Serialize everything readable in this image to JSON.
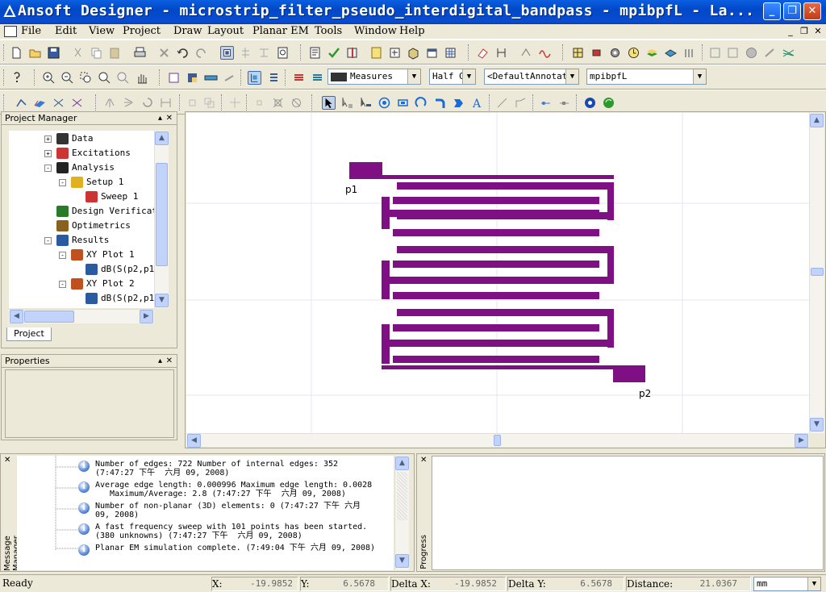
{
  "window": {
    "title": "Ansoft Designer  - microstrip_filter_pseudo_interdigital_bandpass - mpibpfL - La...",
    "buttons": {
      "minimize": "_",
      "maximize": "❐",
      "close": "✕"
    }
  },
  "menu": {
    "items": [
      "File",
      "Edit",
      "View",
      "Project",
      "Draw",
      "Layout",
      "Planar EM",
      "Tools",
      "Window",
      "Help"
    ],
    "mdi": {
      "minimize": "_",
      "restore": "❐",
      "close": "✕"
    }
  },
  "toolbar": {
    "layer_combo": "Measures",
    "snap_combo": "Half G",
    "annotation_combo": "<DefaultAnnotati",
    "design_combo": "mpibpfL"
  },
  "project_manager": {
    "title": "Project Manager",
    "tab": "Project",
    "tree": [
      {
        "label": "Data",
        "indent": 0,
        "expander": "+",
        "icon": "data-icon"
      },
      {
        "label": "Excitations",
        "indent": 0,
        "expander": "+",
        "icon": "excitations-icon"
      },
      {
        "label": "Analysis",
        "indent": 0,
        "expander": "-",
        "icon": "analysis-icon"
      },
      {
        "label": "Setup 1",
        "indent": 1,
        "expander": "-",
        "icon": "setup-icon"
      },
      {
        "label": "Sweep 1",
        "indent": 2,
        "expander": "",
        "icon": "sweep-icon"
      },
      {
        "label": "Design Verificati",
        "indent": 0,
        "expander": "",
        "icon": "verification-icon"
      },
      {
        "label": "Optimetrics",
        "indent": 0,
        "expander": "",
        "icon": "optimetrics-icon"
      },
      {
        "label": "Results",
        "indent": 0,
        "expander": "-",
        "icon": "results-icon"
      },
      {
        "label": "XY Plot 1",
        "indent": 1,
        "expander": "-",
        "icon": "xy-plot-icon"
      },
      {
        "label": "dB(S(p2,p1",
        "indent": 2,
        "expander": "",
        "icon": "trace-icon"
      },
      {
        "label": "XY Plot 2",
        "indent": 1,
        "expander": "-",
        "icon": "xy-plot-icon"
      },
      {
        "label": "dB(S(p2,p1",
        "indent": 2,
        "expander": "",
        "icon": "trace-icon"
      }
    ]
  },
  "properties": {
    "title": "Properties"
  },
  "layout": {
    "port1": "p1",
    "port2": "p2",
    "trace_color": "#7f1084"
  },
  "messages": {
    "side_label": "Message Manager",
    "items": [
      {
        "line1": "Number of edges: 722   Number of internal edges: 352",
        "line2": "(7:47:27 下午  六月 09, 2008)"
      },
      {
        "line1": "Average edge length: 0.000996    Maximum edge length: 0.0028",
        "line2": "   Maximum/Average: 2.8 (7:47:27 下午  六月 09, 2008)"
      },
      {
        "line1": "Number of non-planar (3D) elements: 0 (7:47:27 下午  六月",
        "line2": "09, 2008)"
      },
      {
        "line1": "A fast frequency sweep with 101 points has been started.",
        "line2": "(380 unknowns) (7:47:27 下午  六月 09, 2008)"
      },
      {
        "line1": "Planar EM simulation complete. (7:49:04 下午  六月 09, 2008)",
        "line2": ""
      }
    ]
  },
  "progress": {
    "side_label": "Progress"
  },
  "status": {
    "ready": "Ready",
    "x_label": "X:",
    "x_value": "-19.9852",
    "y_label": "Y:",
    "y_value": "6.5678",
    "dx_label": "Delta X:",
    "dx_value": "-19.9852",
    "dy_label": "Delta Y:",
    "dy_value": "6.5678",
    "dist_label": "Distance:",
    "dist_value": "21.0367",
    "units": "mm"
  }
}
